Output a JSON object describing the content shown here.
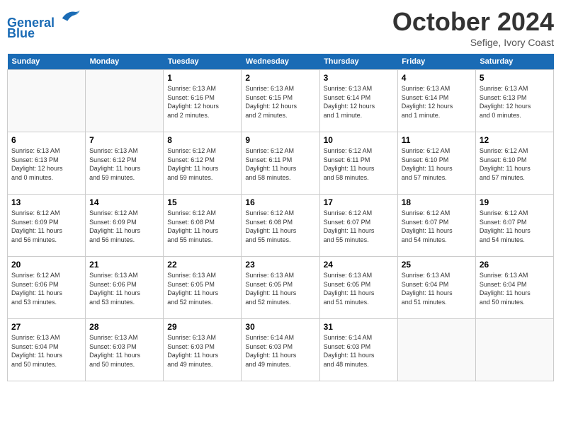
{
  "header": {
    "logo_line1": "General",
    "logo_line2": "Blue",
    "month": "October 2024",
    "location": "Sefige, Ivory Coast"
  },
  "days_of_week": [
    "Sunday",
    "Monday",
    "Tuesday",
    "Wednesday",
    "Thursday",
    "Friday",
    "Saturday"
  ],
  "weeks": [
    [
      {
        "day": "",
        "info": ""
      },
      {
        "day": "",
        "info": ""
      },
      {
        "day": "1",
        "info": "Sunrise: 6:13 AM\nSunset: 6:16 PM\nDaylight: 12 hours\nand 2 minutes."
      },
      {
        "day": "2",
        "info": "Sunrise: 6:13 AM\nSunset: 6:15 PM\nDaylight: 12 hours\nand 2 minutes."
      },
      {
        "day": "3",
        "info": "Sunrise: 6:13 AM\nSunset: 6:14 PM\nDaylight: 12 hours\nand 1 minute."
      },
      {
        "day": "4",
        "info": "Sunrise: 6:13 AM\nSunset: 6:14 PM\nDaylight: 12 hours\nand 1 minute."
      },
      {
        "day": "5",
        "info": "Sunrise: 6:13 AM\nSunset: 6:13 PM\nDaylight: 12 hours\nand 0 minutes."
      }
    ],
    [
      {
        "day": "6",
        "info": "Sunrise: 6:13 AM\nSunset: 6:13 PM\nDaylight: 12 hours\nand 0 minutes."
      },
      {
        "day": "7",
        "info": "Sunrise: 6:13 AM\nSunset: 6:12 PM\nDaylight: 11 hours\nand 59 minutes."
      },
      {
        "day": "8",
        "info": "Sunrise: 6:12 AM\nSunset: 6:12 PM\nDaylight: 11 hours\nand 59 minutes."
      },
      {
        "day": "9",
        "info": "Sunrise: 6:12 AM\nSunset: 6:11 PM\nDaylight: 11 hours\nand 58 minutes."
      },
      {
        "day": "10",
        "info": "Sunrise: 6:12 AM\nSunset: 6:11 PM\nDaylight: 11 hours\nand 58 minutes."
      },
      {
        "day": "11",
        "info": "Sunrise: 6:12 AM\nSunset: 6:10 PM\nDaylight: 11 hours\nand 57 minutes."
      },
      {
        "day": "12",
        "info": "Sunrise: 6:12 AM\nSunset: 6:10 PM\nDaylight: 11 hours\nand 57 minutes."
      }
    ],
    [
      {
        "day": "13",
        "info": "Sunrise: 6:12 AM\nSunset: 6:09 PM\nDaylight: 11 hours\nand 56 minutes."
      },
      {
        "day": "14",
        "info": "Sunrise: 6:12 AM\nSunset: 6:09 PM\nDaylight: 11 hours\nand 56 minutes."
      },
      {
        "day": "15",
        "info": "Sunrise: 6:12 AM\nSunset: 6:08 PM\nDaylight: 11 hours\nand 55 minutes."
      },
      {
        "day": "16",
        "info": "Sunrise: 6:12 AM\nSunset: 6:08 PM\nDaylight: 11 hours\nand 55 minutes."
      },
      {
        "day": "17",
        "info": "Sunrise: 6:12 AM\nSunset: 6:07 PM\nDaylight: 11 hours\nand 55 minutes."
      },
      {
        "day": "18",
        "info": "Sunrise: 6:12 AM\nSunset: 6:07 PM\nDaylight: 11 hours\nand 54 minutes."
      },
      {
        "day": "19",
        "info": "Sunrise: 6:12 AM\nSunset: 6:07 PM\nDaylight: 11 hours\nand 54 minutes."
      }
    ],
    [
      {
        "day": "20",
        "info": "Sunrise: 6:12 AM\nSunset: 6:06 PM\nDaylight: 11 hours\nand 53 minutes."
      },
      {
        "day": "21",
        "info": "Sunrise: 6:13 AM\nSunset: 6:06 PM\nDaylight: 11 hours\nand 53 minutes."
      },
      {
        "day": "22",
        "info": "Sunrise: 6:13 AM\nSunset: 6:05 PM\nDaylight: 11 hours\nand 52 minutes."
      },
      {
        "day": "23",
        "info": "Sunrise: 6:13 AM\nSunset: 6:05 PM\nDaylight: 11 hours\nand 52 minutes."
      },
      {
        "day": "24",
        "info": "Sunrise: 6:13 AM\nSunset: 6:05 PM\nDaylight: 11 hours\nand 51 minutes."
      },
      {
        "day": "25",
        "info": "Sunrise: 6:13 AM\nSunset: 6:04 PM\nDaylight: 11 hours\nand 51 minutes."
      },
      {
        "day": "26",
        "info": "Sunrise: 6:13 AM\nSunset: 6:04 PM\nDaylight: 11 hours\nand 50 minutes."
      }
    ],
    [
      {
        "day": "27",
        "info": "Sunrise: 6:13 AM\nSunset: 6:04 PM\nDaylight: 11 hours\nand 50 minutes."
      },
      {
        "day": "28",
        "info": "Sunrise: 6:13 AM\nSunset: 6:03 PM\nDaylight: 11 hours\nand 50 minutes."
      },
      {
        "day": "29",
        "info": "Sunrise: 6:13 AM\nSunset: 6:03 PM\nDaylight: 11 hours\nand 49 minutes."
      },
      {
        "day": "30",
        "info": "Sunrise: 6:14 AM\nSunset: 6:03 PM\nDaylight: 11 hours\nand 49 minutes."
      },
      {
        "day": "31",
        "info": "Sunrise: 6:14 AM\nSunset: 6:03 PM\nDaylight: 11 hours\nand 48 minutes."
      },
      {
        "day": "",
        "info": ""
      },
      {
        "day": "",
        "info": ""
      }
    ]
  ]
}
